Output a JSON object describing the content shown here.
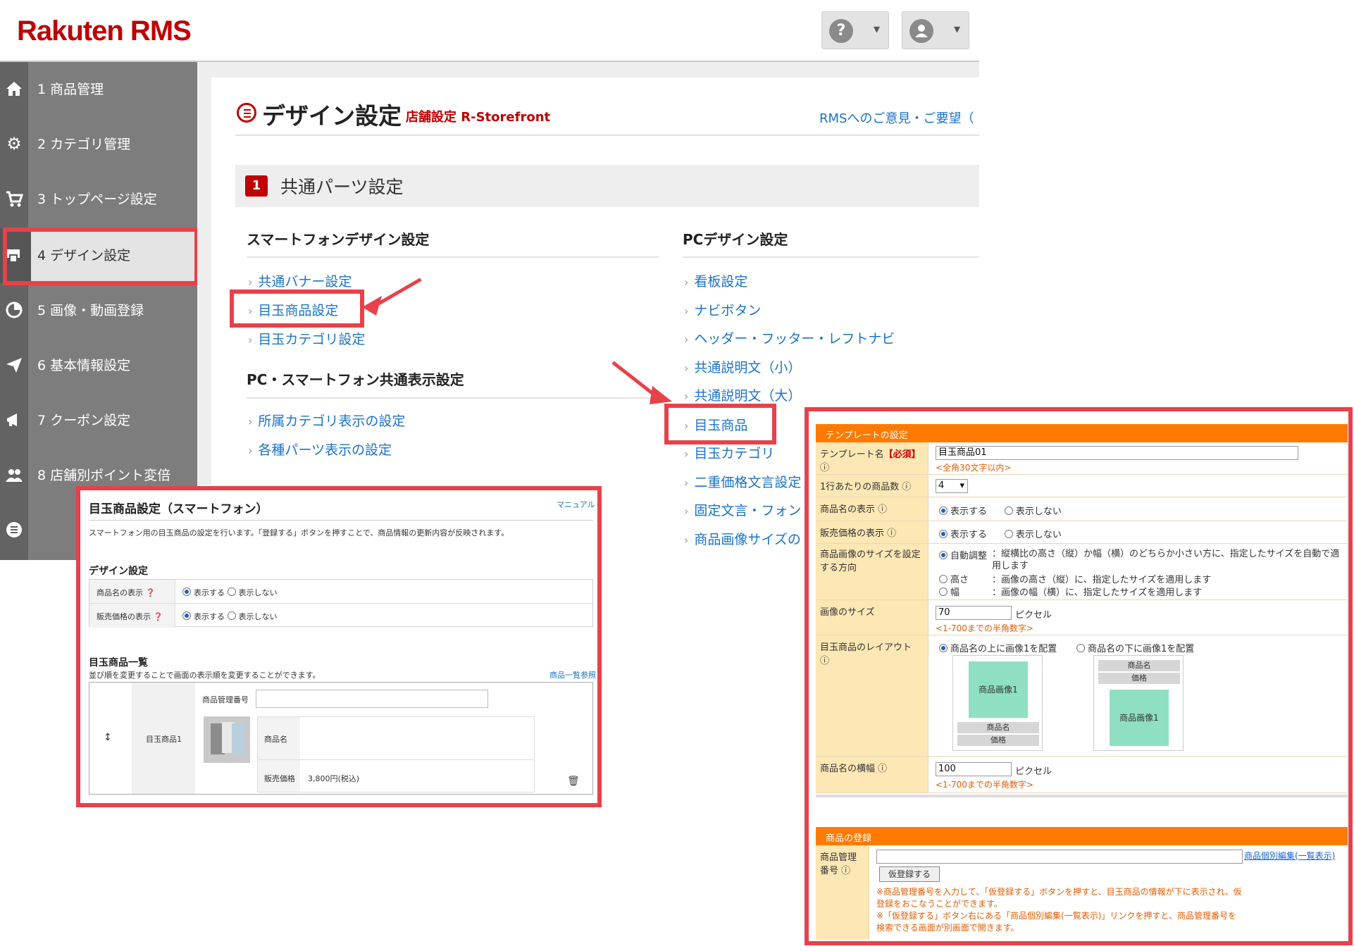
{
  "header": {
    "logo": "Rakuten RMS",
    "help_symbol": "?",
    "chevron": "⌄"
  },
  "sidebar": {
    "items": [
      {
        "label": "1  商品管理",
        "icon": "home-icon"
      },
      {
        "label": "2  カテゴリ管理",
        "icon": "gear-icon"
      },
      {
        "label": "3  トップページ設定",
        "icon": "cart-icon"
      },
      {
        "label": "4  デザイン設定",
        "icon": "design-icon"
      },
      {
        "label": "5  画像・動画登録",
        "icon": "pie-icon"
      },
      {
        "label": "6  基本情報設定",
        "icon": "send-icon"
      },
      {
        "label": "7  クーポン設定",
        "icon": "megaphone-icon"
      },
      {
        "label": "8  店舗別ポイント変倍",
        "icon": "users-icon"
      },
      {
        "label": "",
        "icon": "list-icon"
      }
    ]
  },
  "page": {
    "title": "デザイン設定",
    "subtitle": "店舗設定 R-Storefront",
    "feedback": "RMSへのご意見・ご要望（",
    "section_num": "1",
    "section_title": "共通パーツ設定"
  },
  "sp_column": {
    "heading": "スマートフォンデザイン設定",
    "links": [
      "共通バナー設定",
      "目玉商品設定",
      "目玉カテゴリ設定"
    ],
    "heading2": "PC・スマートフォン共通表示設定",
    "links2": [
      "所属カテゴリ表示の設定",
      "各種パーツ表示の設定"
    ]
  },
  "pc_column": {
    "heading": "PCデザイン設定",
    "links": [
      "看板設定",
      "ナビボタン",
      "ヘッダー・フッター・レフトナビ",
      "共通説明文（小）",
      "共通説明文（大）",
      "目玉商品",
      "目玉カテゴリ",
      "二重価格文言設定",
      "固定文言・フォン",
      "商品画像サイズの"
    ]
  },
  "sp_panel": {
    "title": "目玉商品設定（スマートフォン）",
    "manual": "マニュアル",
    "desc": "スマートフォン用の目玉商品の設定を行います。「登録する」ボタンを押すことで、商品情報の更新内容が反映されます。",
    "design_heading": "デザイン設定",
    "row1_label": "商品名の表示",
    "row2_label": "販売価格の表示",
    "show": "表示する",
    "hide": "表示しない",
    "list_heading": "目玉商品一覧",
    "list_desc": "並び順を変更することで画面の表示順を変更することができます。",
    "list_link": "商品一覧参照",
    "item_name": "目玉商品1",
    "mgmt_label": "商品管理番号",
    "name_label": "商品名",
    "price_label": "販売価格",
    "price_value": "3,800円(税込)"
  },
  "pc_panel": {
    "template_head": "テンプレートの設定",
    "template_name_label": "テンプレート名",
    "required": "【必須】",
    "template_name_value": "目玉商品01",
    "template_name_note": "<全角30文字以内>",
    "per_row_label": "1行あたりの商品数",
    "per_row_value": "4",
    "name_disp_label": "商品名の表示",
    "price_disp_label": "販売価格の表示",
    "show": "表示する",
    "hide": "表示しない",
    "img_dir_label": "商品画像のサイズを設定する方向",
    "dir_auto": "自動調整",
    "dir_auto_desc": "：縦横比の高さ（縦）か幅（横）のどちらか小さい方に、指定したサイズを自動で適用します",
    "dir_height": "高さ",
    "dir_height_desc": "：画像の高さ（縦）に、指定したサイズを適用します",
    "dir_width": "幅",
    "dir_width_desc": "：画像の幅（横）に、指定したサイズを適用します",
    "img_size_label": "画像のサイズ",
    "img_size_value": "70",
    "pixel": "ピクセル",
    "size_note": "<1-700までの半角数字>",
    "layout_label": "目玉商品のレイアウト",
    "layout_opt1": "商品名の上に画像1を配置",
    "layout_opt2": "商品名の下に画像1を配置",
    "img1": "商品画像1",
    "name": "商品名",
    "price": "価格",
    "name_width_label": "商品名の横幅",
    "name_width_value": "100",
    "register_head": "商品の登録",
    "mgmt_label": "商品管理番号",
    "bulk_link": "商品個別編集(一覧表示)",
    "temp_register": "仮登録する",
    "note1": "※商品管理番号を入力して、「仮登録する」ボタンを押すと、目玉商品の情報が下に表示され、仮登録をおこなうことができます。",
    "note2": "※「仮登録する」ボタン右にある「商品個別編集(一覧表示)」リンクを押すと、商品管理番号を検索できる画面が別画面で開きます。"
  },
  "colors": {
    "brand_red": "#bf0000",
    "highlight_red": "#e8414a",
    "link_blue": "#1a73c9",
    "header_orange": "#ff7a00",
    "label_cream": "#fde7b4",
    "image_green": "#8ee0c0"
  }
}
